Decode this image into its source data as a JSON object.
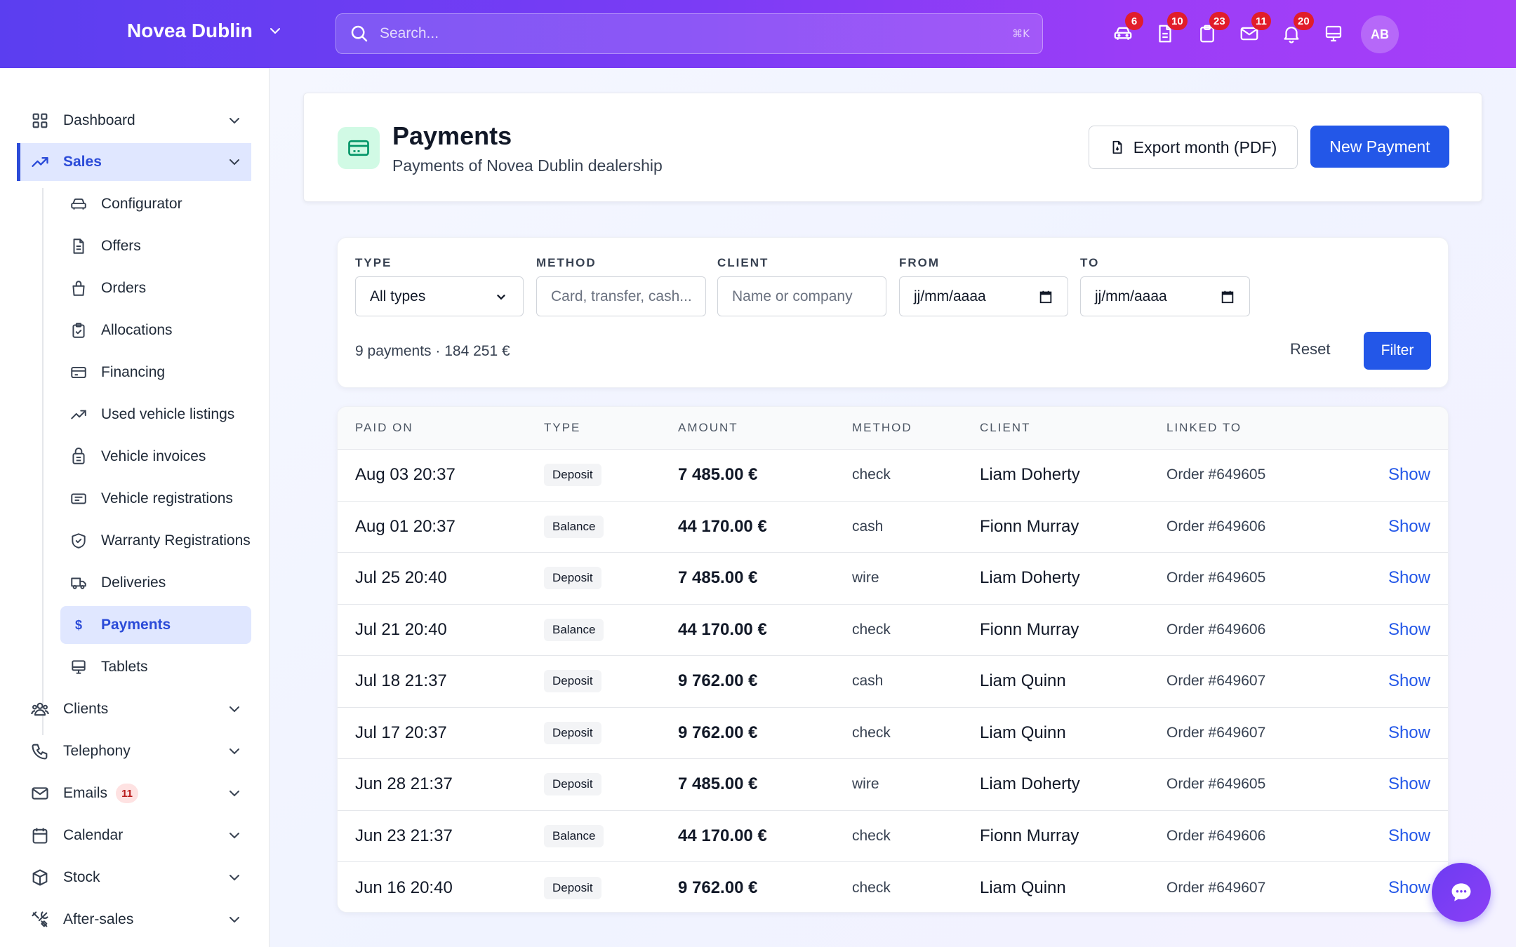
{
  "topbar": {
    "brand": "Novea Dublin",
    "search_placeholder": "Search...",
    "search_shortcut": "⌘K",
    "icons": [
      {
        "icon": "car-icon",
        "badge": "6"
      },
      {
        "icon": "document-icon",
        "badge": "10"
      },
      {
        "icon": "clipboard-icon",
        "badge": "23"
      },
      {
        "icon": "mail-icon",
        "badge": "11"
      },
      {
        "icon": "bell-icon",
        "badge": "20"
      },
      {
        "icon": "monitor-icon",
        "badge": ""
      }
    ],
    "avatar": "AB"
  },
  "sidebar": {
    "sections": [
      {
        "label": "Dashboard",
        "icon": "grid-icon"
      },
      {
        "label": "Sales",
        "icon": "trend-up-icon"
      },
      {
        "label": "Clients",
        "icon": "users-icon"
      },
      {
        "label": "Telephony",
        "icon": "phone-icon"
      },
      {
        "label": "Emails",
        "icon": "mail-icon",
        "count": "11"
      },
      {
        "label": "Calendar",
        "icon": "calendar-icon"
      },
      {
        "label": "Stock",
        "icon": "box-icon"
      },
      {
        "label": "After-sales",
        "icon": "tools-icon"
      }
    ],
    "sales_items": [
      {
        "label": "Configurator",
        "icon": "car-icon"
      },
      {
        "label": "Offers",
        "icon": "document-icon"
      },
      {
        "label": "Orders",
        "icon": "bag-icon"
      },
      {
        "label": "Allocations",
        "icon": "clipboard-check-icon"
      },
      {
        "label": "Financing",
        "icon": "credit-card-icon"
      },
      {
        "label": "Used vehicle listings",
        "icon": "trend-up-icon"
      },
      {
        "label": "Vehicle invoices",
        "icon": "invoice-icon"
      },
      {
        "label": "Vehicle registrations",
        "icon": "id-card-icon"
      },
      {
        "label": "Warranty Registrations",
        "icon": "shield-icon"
      },
      {
        "label": "Deliveries",
        "icon": "truck-icon"
      },
      {
        "label": "Payments",
        "icon": "dollar-icon"
      },
      {
        "label": "Tablets",
        "icon": "monitor-icon"
      }
    ]
  },
  "header": {
    "title": "Payments",
    "subtitle": "Payments of Novea Dublin dealership",
    "export_label": "Export month (PDF)",
    "new_label": "New Payment"
  },
  "filters": {
    "type_label": "TYPE",
    "type_value": "All types",
    "method_label": "METHOD",
    "method_placeholder": "Card, transfer, cash...",
    "client_label": "CLIENT",
    "client_placeholder": "Name or company",
    "from_label": "FROM",
    "from_value": "jj/mm/aaaa",
    "to_label": "TO",
    "to_value": "jj/mm/aaaa",
    "summary": "9 payments · 184 251 €",
    "reset_label": "Reset",
    "filter_label": "Filter"
  },
  "table": {
    "columns": [
      "PAID ON",
      "TYPE",
      "AMOUNT",
      "METHOD",
      "CLIENT",
      "LINKED TO"
    ],
    "show_label": "Show",
    "rows": [
      {
        "date": "Aug 03 20:37",
        "type": "Deposit",
        "amount": "7 485.00 €",
        "method": "check",
        "client": "Liam Doherty",
        "linked": "Order #649605"
      },
      {
        "date": "Aug 01 20:37",
        "type": "Balance",
        "amount": "44 170.00 €",
        "method": "cash",
        "client": "Fionn Murray",
        "linked": "Order #649606"
      },
      {
        "date": "Jul 25 20:40",
        "type": "Deposit",
        "amount": "7 485.00 €",
        "method": "wire",
        "client": "Liam Doherty",
        "linked": "Order #649605"
      },
      {
        "date": "Jul 21 20:40",
        "type": "Balance",
        "amount": "44 170.00 €",
        "method": "check",
        "client": "Fionn Murray",
        "linked": "Order #649606"
      },
      {
        "date": "Jul 18 21:37",
        "type": "Deposit",
        "amount": "9 762.00 €",
        "method": "cash",
        "client": "Liam Quinn",
        "linked": "Order #649607"
      },
      {
        "date": "Jul 17 20:37",
        "type": "Deposit",
        "amount": "9 762.00 €",
        "method": "check",
        "client": "Liam Quinn",
        "linked": "Order #649607"
      },
      {
        "date": "Jun 28 21:37",
        "type": "Deposit",
        "amount": "7 485.00 €",
        "method": "wire",
        "client": "Liam Doherty",
        "linked": "Order #649605"
      },
      {
        "date": "Jun 23 21:37",
        "type": "Balance",
        "amount": "44 170.00 €",
        "method": "check",
        "client": "Fionn Murray",
        "linked": "Order #649606"
      },
      {
        "date": "Jun 16 20:40",
        "type": "Deposit",
        "amount": "9 762.00 €",
        "method": "check",
        "client": "Liam Quinn",
        "linked": "Order #649607"
      }
    ]
  },
  "colors": {
    "brand_start": "#5b3ef0",
    "brand_end": "#a63ff8",
    "primary": "#2357e8",
    "badge": "#e11d2a"
  }
}
